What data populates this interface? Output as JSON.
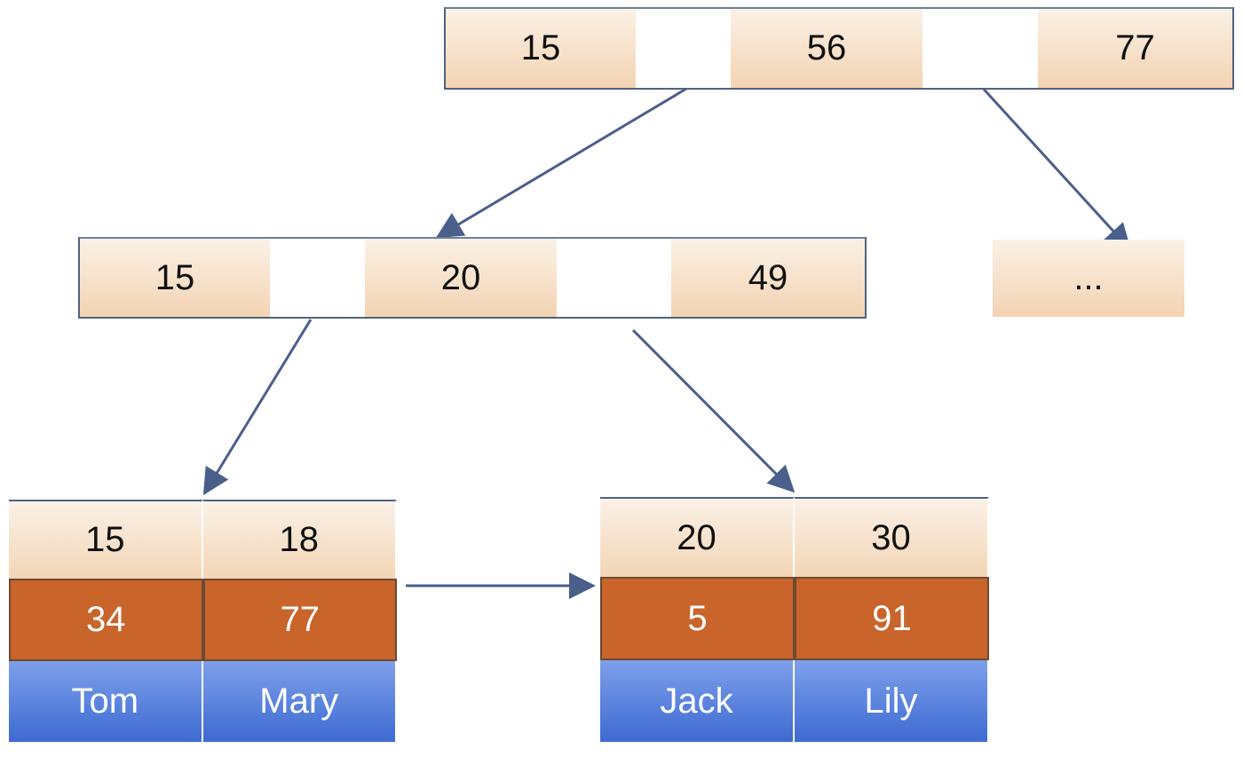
{
  "root": {
    "keys": [
      "15",
      "56",
      "77"
    ]
  },
  "internal": {
    "keys": [
      "15",
      "20",
      "49"
    ]
  },
  "sibling": {
    "label": "..."
  },
  "leaf_left": {
    "keys": [
      "15",
      "18"
    ],
    "values": [
      "34",
      "77"
    ],
    "names": [
      "Tom",
      "Mary"
    ]
  },
  "leaf_right": {
    "keys": [
      "20",
      "30"
    ],
    "values": [
      "5",
      "91"
    ],
    "names": [
      "Jack",
      "Lily"
    ]
  },
  "colors": {
    "key_fill": "#f3d3b2",
    "value_fill": "#c9642a",
    "name_fill": "#4a76d8",
    "arrow": "#4a5f8a"
  }
}
